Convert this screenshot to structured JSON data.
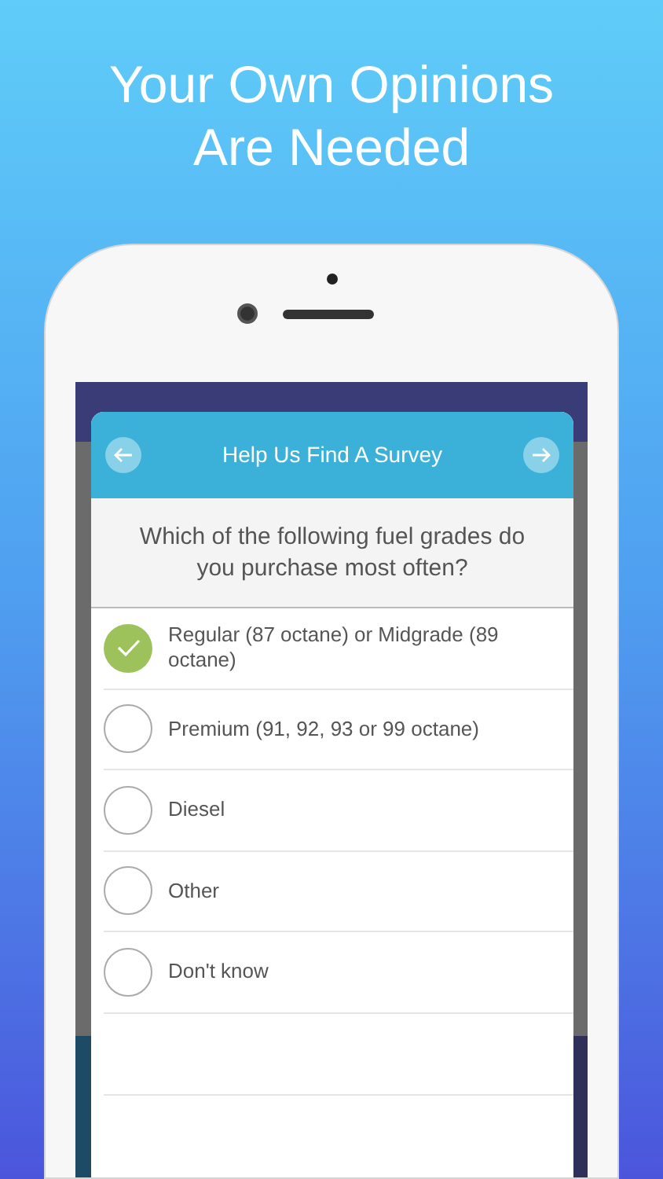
{
  "headline": "Your Own Opinions Are Needed",
  "survey": {
    "title": "Help Us Find A Survey",
    "question": "Which of the following fuel grades do you purchase most often?",
    "options": [
      {
        "label": "Regular (87 octane) or Midgrade (89 octane)",
        "selected": true
      },
      {
        "label": "Premium (91, 92, 93 or 99 octane)",
        "selected": false
      },
      {
        "label": "Diesel",
        "selected": false
      },
      {
        "label": "Other",
        "selected": false
      },
      {
        "label": "Don't know",
        "selected": false
      }
    ]
  }
}
